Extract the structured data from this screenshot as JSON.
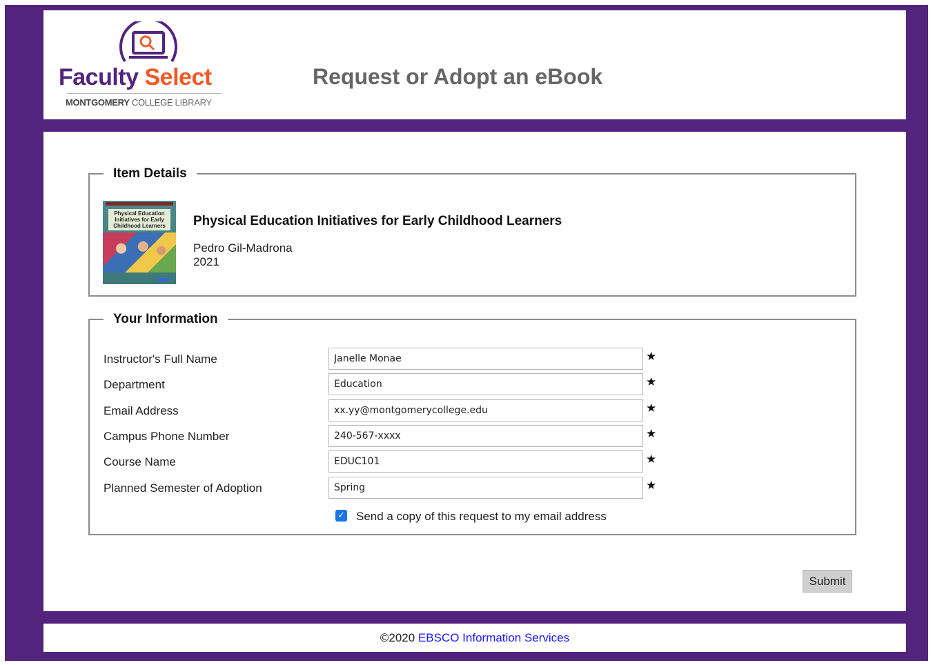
{
  "header": {
    "logo": {
      "word1": "Faculty",
      "word2": "Select",
      "sub1": "MONTGOMERY",
      "sub2": "COLLEGE",
      "sub3": "LIBRARY"
    },
    "title": "Request or Adopt an eBook"
  },
  "item_details": {
    "legend": "Item Details",
    "cover": {
      "lines": "Physical Education Initiatives for Early Childhood Learners"
    },
    "book_title": "Physical Education Initiatives for Early Childhood Learners",
    "author": "Pedro Gil-Madrona",
    "year": "2021"
  },
  "your_information": {
    "legend": "Your Information",
    "fields": [
      {
        "label": "Instructor's Full Name",
        "value": "Janelle Monae"
      },
      {
        "label": "Department",
        "value": "Education"
      },
      {
        "label": "Email Address",
        "value": "xx.yy@montgomerycollege.edu"
      },
      {
        "label": "Campus Phone Number",
        "value": "240-567-xxxx"
      },
      {
        "label": "Course Name",
        "value": "EDUC101"
      },
      {
        "label": "Planned Semester of Adoption",
        "value": "Spring"
      }
    ],
    "required_mark": "★",
    "copy_checkbox": {
      "label": "Send a copy of this request to my email address",
      "checked": true
    }
  },
  "submit_label": "Submit",
  "footer": {
    "copyright": "©2020",
    "link_text": "EBSCO Information Services"
  },
  "colors": {
    "brand_purple": "#53247d",
    "brand_orange": "#f05a28",
    "link_blue": "#1a1aff"
  }
}
